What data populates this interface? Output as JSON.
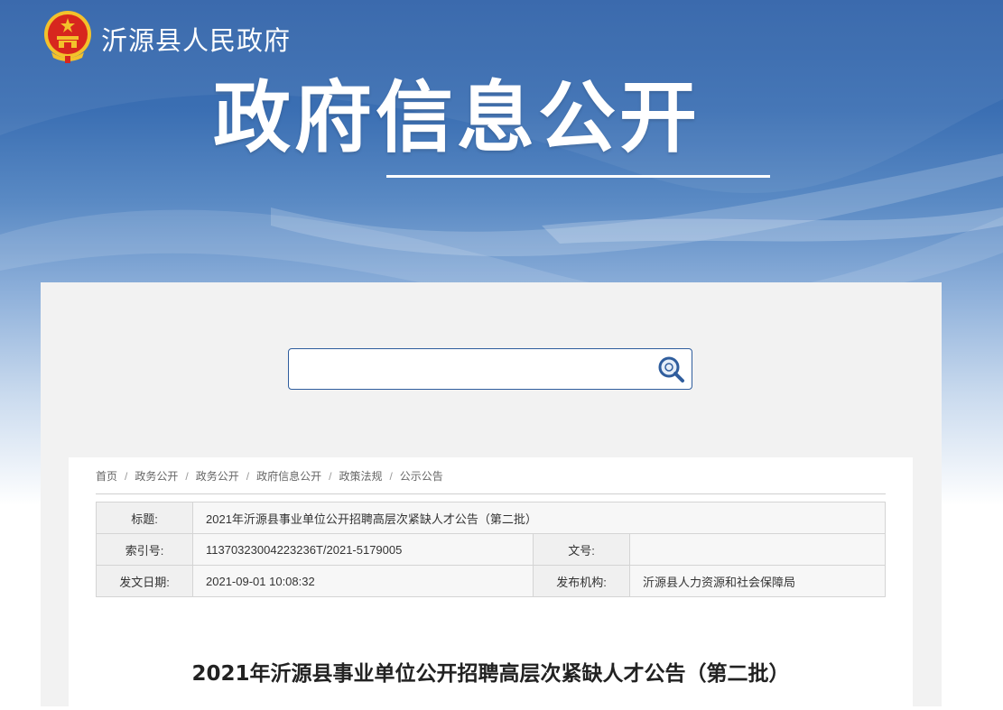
{
  "site": {
    "name": "沂源县人民政府"
  },
  "banner": {
    "title": "政府信息公开"
  },
  "search": {
    "value": "",
    "placeholder": ""
  },
  "breadcrumb": [
    "首页",
    "政务公开",
    "政务公开",
    "政府信息公开",
    "政策法规",
    "公示公告"
  ],
  "meta": {
    "title_label": "标题:",
    "title_value": "2021年沂源县事业单位公开招聘高层次紧缺人才公告（第二批）",
    "index_label": "索引号:",
    "index_value": "11370323004223236T/2021-5179005",
    "docno_label": "文号:",
    "docno_value": "",
    "date_label": "发文日期:",
    "date_value": "2021-09-01 10:08:32",
    "org_label": "发布机构:",
    "org_value": "沂源县人力资源和社会保障局"
  },
  "document": {
    "title": "2021年沂源县事业单位公开招聘高层次紧缺人才公告（第二批）"
  },
  "colors": {
    "banner_blue": "#2f61a8",
    "search_border": "#2f5d9d",
    "emblem_red": "#d7261e",
    "emblem_gold": "#f3c12b"
  }
}
